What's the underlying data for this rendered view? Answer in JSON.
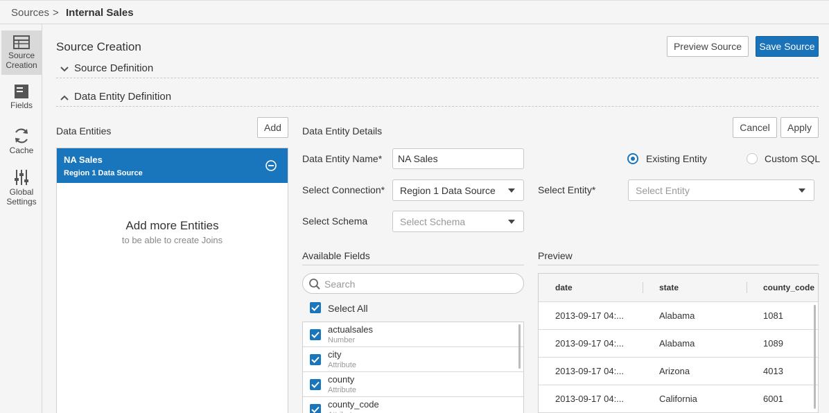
{
  "breadcrumb": {
    "parent": "Sources",
    "separator": ">",
    "current": "Internal Sales"
  },
  "nav": [
    {
      "label": "Source\nCreation",
      "icon": "table-icon",
      "active": true
    },
    {
      "label": "Fields",
      "icon": "fields-icon"
    },
    {
      "label": "Cache",
      "icon": "refresh-icon"
    },
    {
      "label": "Global\nSettings",
      "icon": "sliders-icon"
    }
  ],
  "header": {
    "title": "Source Creation",
    "preview_label": "Preview Source",
    "save_label": "Save Source"
  },
  "sections": {
    "source_definition": "Source Definition",
    "data_entity_definition": "Data Entity Definition"
  },
  "entities": {
    "title": "Data Entities",
    "add_label": "Add",
    "items": [
      {
        "name": "NA Sales",
        "source": "Region 1 Data Source"
      }
    ],
    "empty_title": "Add more Entities",
    "empty_subtitle": "to be able to create Joins"
  },
  "details": {
    "title": "Data Entity Details",
    "cancel_label": "Cancel",
    "apply_label": "Apply",
    "name_label": "Data Entity Name*",
    "name_value": "NA Sales",
    "existing_label": "Existing Entity",
    "custom_label": "Custom SQL",
    "connection_label": "Select Connection*",
    "connection_value": "Region 1 Data Source",
    "entity_label": "Select Entity*",
    "entity_placeholder": "Select Entity",
    "schema_label": "Select Schema",
    "schema_placeholder": "Select Schema"
  },
  "available_fields": {
    "title": "Available Fields",
    "search_placeholder": "Search",
    "select_all_label": "Select All",
    "items": [
      {
        "name": "actualsales",
        "type": "Number"
      },
      {
        "name": "city",
        "type": "Attribute"
      },
      {
        "name": "county",
        "type": "Attribute"
      },
      {
        "name": "county_code",
        "type": "Attribute"
      }
    ]
  },
  "preview": {
    "title": "Preview",
    "columns": [
      "date",
      "state",
      "county_code"
    ],
    "rows": [
      [
        "2013-09-17 04:...",
        "Alabama",
        "1081"
      ],
      [
        "2013-09-17 04:...",
        "Alabama",
        "1089"
      ],
      [
        "2013-09-17 04:...",
        "Arizona",
        "4013"
      ],
      [
        "2013-09-17 04:...",
        "California",
        "6001"
      ]
    ]
  },
  "colors": {
    "accent": "#1976bd",
    "primary_button": "#1a73b8"
  }
}
